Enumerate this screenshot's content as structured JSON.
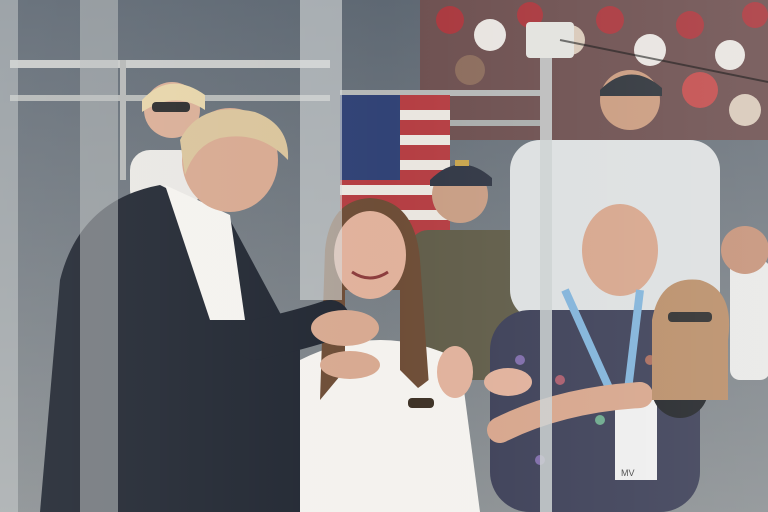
{
  "photo": {
    "palette": {
      "sky": "#8c9aa6",
      "crowd_red": "#a8343a",
      "crowd_white": "#e8e4e0",
      "glass_frame": "#d9dcdc",
      "suit": "#1f2530",
      "shirt": "#f4f2ee",
      "skin": "#d7a88f",
      "hair_blonde": "#d9c39a",
      "hair_brown": "#6b4a33",
      "lanyard": "#7fb2d9"
    },
    "badge_text": "MV"
  }
}
